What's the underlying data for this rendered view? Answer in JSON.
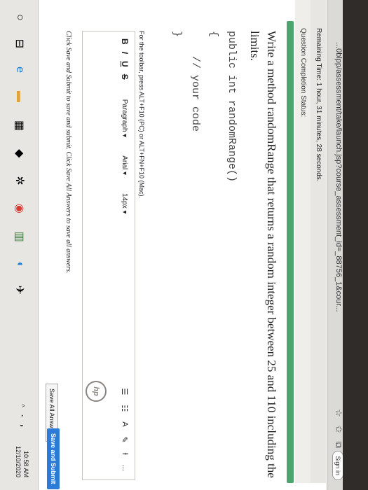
{
  "browser": {
    "url": "...0blpp/assessment/take/launch.jsp?course_assessment_id=_88756_1&cour...",
    "sign_in_label": "Sign in"
  },
  "header": {
    "remaining_time": "Remaining Time: 1 hour, 31 minutes, 28 seconds.",
    "completion_status": "Question Completion Status:"
  },
  "question": {
    "title": "Write a method randomRange that returns a random integer between 25 and 110 including the limits.",
    "code_lines": [
      "public int randomRange()",
      "{",
      "    // your code",
      "}"
    ]
  },
  "editor": {
    "toolbar_note": "For the toolbar, press ALT+F10 (PC) or ALT+FN+F10 (Mac).",
    "bold": "B",
    "italic": "I",
    "underline": "U",
    "strike": "S",
    "paragraph": "Paragraph",
    "font": "Arial",
    "size": "14px",
    "more": "..."
  },
  "footer": {
    "note": "Click Save and Submit to save and submit. Click Save All Answers to save all answers.",
    "save_all": "Save All Answers",
    "save_submit": "Save and Submit"
  },
  "taskbar": {
    "time": "10:58 AM",
    "date": "12/10/2020"
  },
  "brand": {
    "logo": "hp"
  }
}
